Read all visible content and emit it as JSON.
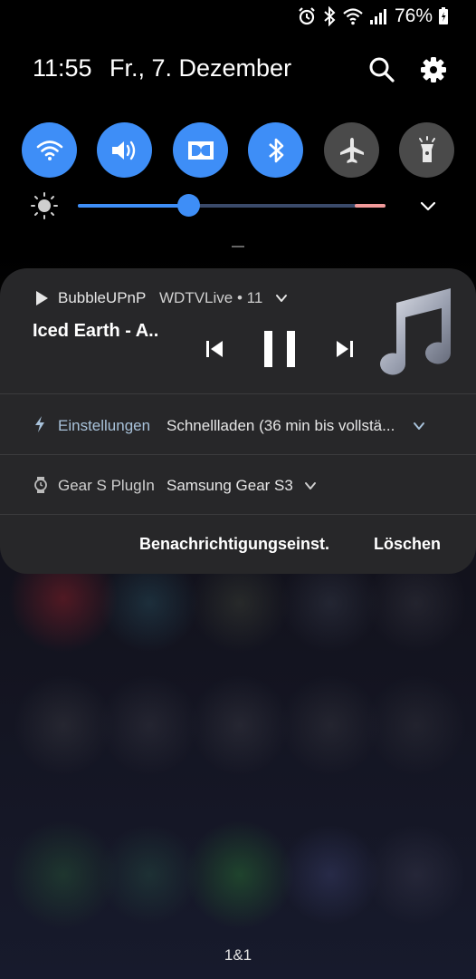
{
  "status_bar": {
    "icons": [
      "alarm-icon",
      "bluetooth-icon",
      "wifi-icon",
      "signal-icon",
      "battery-icon"
    ],
    "battery_percent": "76%"
  },
  "header": {
    "time": "11:55",
    "date": "Fr., 7. Dezember"
  },
  "quick_settings": {
    "toggles": [
      {
        "icon": "wifi-icon",
        "state": "on"
      },
      {
        "icon": "sound-icon",
        "state": "on"
      },
      {
        "icon": "dolby-icon",
        "state": "on"
      },
      {
        "icon": "bluetooth-icon",
        "state": "on"
      },
      {
        "icon": "airplane-icon",
        "state": "off"
      },
      {
        "icon": "flashlight-icon",
        "state": "off"
      }
    ],
    "brightness_level": 0.36
  },
  "notifications": {
    "media": {
      "app": "BubbleUPnP",
      "device": "WDTVLive • 11",
      "title": "Iced Earth - A..",
      "playing": true
    },
    "charging": {
      "app": "Einstellungen",
      "text": "Schnellladen (36 min bis vollstä..."
    },
    "gear": {
      "app": "Gear S PlugIn",
      "text": "Samsung Gear S3"
    },
    "actions": {
      "settings_label": "Benachrichtigungseinst.",
      "clear_label": "Löschen"
    }
  },
  "footer": {
    "carrier": "1&1"
  },
  "colors": {
    "accent": "#3e8ef7",
    "panel": "#272729",
    "toggle_off": "#4a4a4a",
    "app_name_charging": "#a8c2da"
  }
}
